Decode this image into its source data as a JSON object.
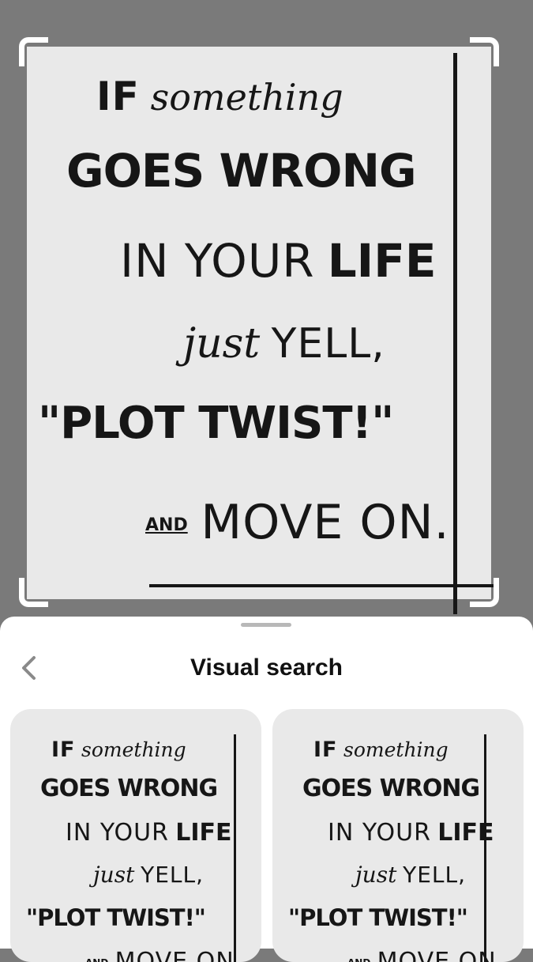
{
  "quote": {
    "line1_caps": "IF",
    "line1_script": "something",
    "line2": "GOES WRONG",
    "line3_caps": "IN YOUR",
    "line3_bold": "LIFE",
    "line4_script": "just",
    "line4_caps": "YELL,",
    "line5": "\"PLOT TWIST!\"",
    "line6_and": "AND",
    "line6_caps": "MOVE ON."
  },
  "sheet": {
    "title": "Visual search",
    "back_icon": "chevron-left-icon"
  },
  "results_count": 2
}
